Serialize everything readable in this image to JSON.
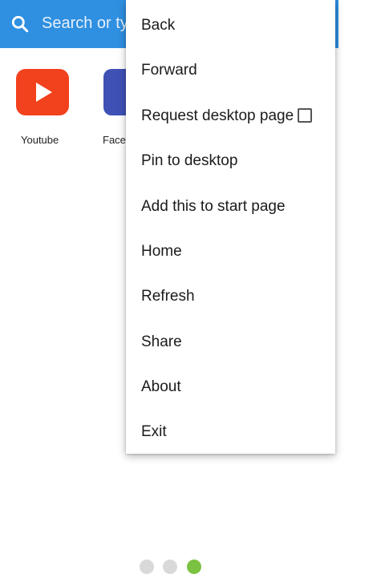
{
  "search": {
    "placeholder": "Search or type URL",
    "icon": "search-icon"
  },
  "shortcuts": [
    {
      "label": "Youtube",
      "color": "#f2411d",
      "icon": "play-icon"
    },
    {
      "label": "Facebook",
      "color": "#3f51b5"
    }
  ],
  "menu": {
    "items": [
      {
        "label": "Back"
      },
      {
        "label": "Forward"
      },
      {
        "label": "Request desktop page",
        "checkbox": false
      },
      {
        "label": "Pin to desktop"
      },
      {
        "label": "Add this to start page"
      },
      {
        "label": "Home"
      },
      {
        "label": "Refresh"
      },
      {
        "label": "Share"
      },
      {
        "label": "About"
      },
      {
        "label": "Exit"
      }
    ]
  },
  "pager": {
    "count": 3,
    "active": 3,
    "active_color": "#7cc242",
    "inactive_color": "#d9d9d9"
  },
  "colors": {
    "accent": "#2f8fe0"
  }
}
